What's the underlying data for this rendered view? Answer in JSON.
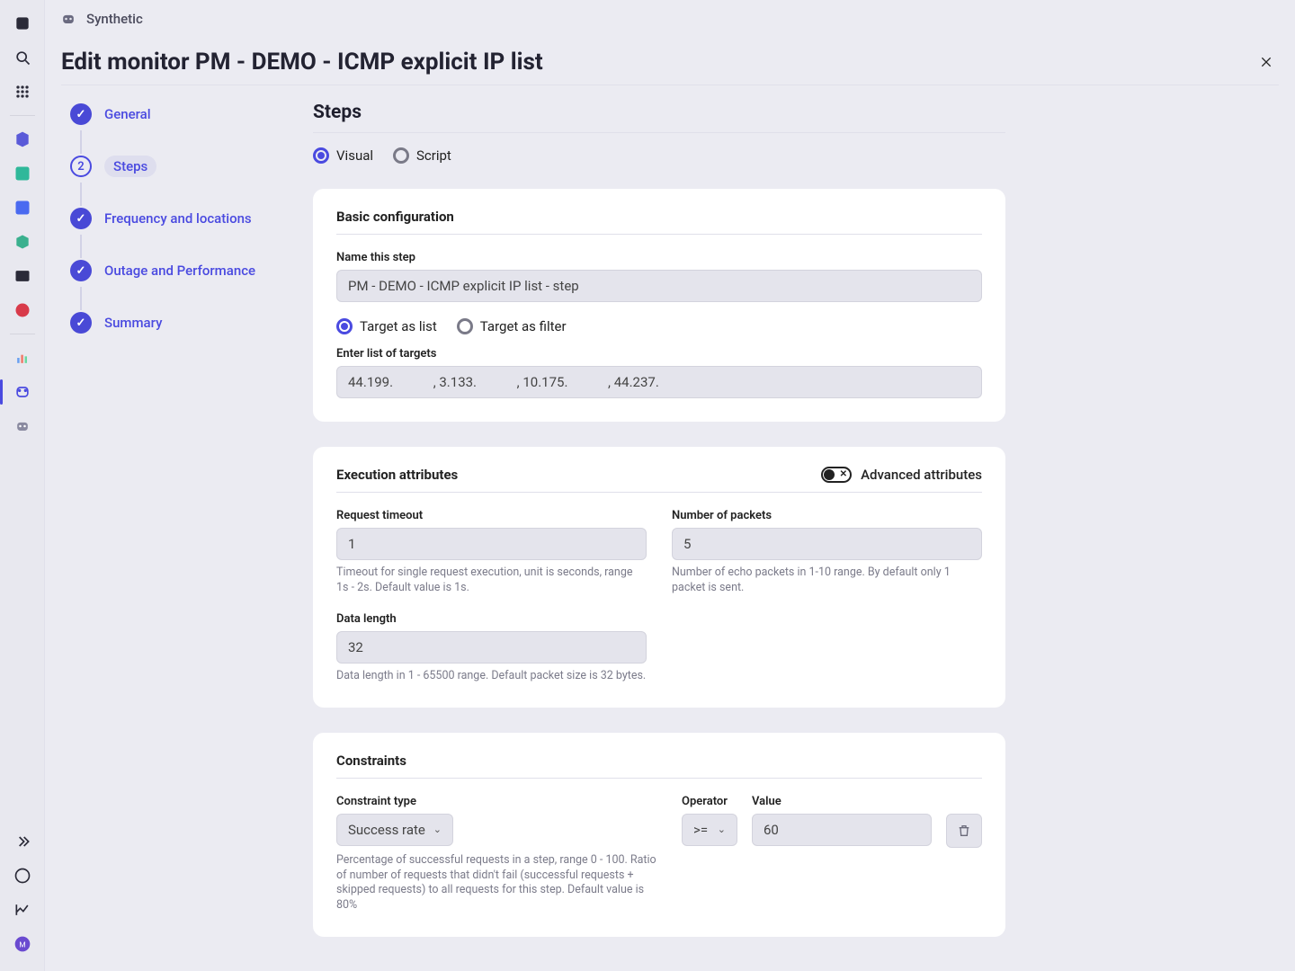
{
  "crumb": {
    "label": "Synthetic"
  },
  "header": {
    "title": "Edit monitor PM - DEMO - ICMP explicit IP list"
  },
  "stepper": {
    "items": [
      {
        "label": "General",
        "state": "done"
      },
      {
        "label": "Steps",
        "state": "current",
        "number": "2"
      },
      {
        "label": "Frequency and locations",
        "state": "done"
      },
      {
        "label": "Outage and Performance",
        "state": "done"
      },
      {
        "label": "Summary",
        "state": "done"
      }
    ]
  },
  "steps": {
    "heading": "Steps",
    "mode": {
      "visual": "Visual",
      "script": "Script",
      "selected": "visual"
    }
  },
  "basic": {
    "title": "Basic configuration",
    "name_label": "Name this step",
    "name_value": "PM - DEMO - ICMP explicit IP list - step",
    "target_mode": {
      "list": "Target as list",
      "filter": "Target as filter",
      "selected": "list"
    },
    "targets_label": "Enter list of targets",
    "targets_value": "44.199.            , 3.133.            , 10.175.            , 44.237."
  },
  "exec": {
    "title": "Execution attributes",
    "advanced_label": "Advanced attributes",
    "timeout": {
      "label": "Request timeout",
      "value": "1",
      "help": "Timeout for single request execution, unit is seconds, range 1s - 2s. Default value is 1s."
    },
    "packets": {
      "label": "Number of packets",
      "value": "5",
      "help": "Number of echo packets in 1-10 range. By default only 1 packet is sent."
    },
    "datalen": {
      "label": "Data length",
      "value": "32",
      "help": "Data length in 1 - 65500 range. Default packet size is 32 bytes."
    }
  },
  "constraints": {
    "title": "Constraints",
    "type_label": "Constraint type",
    "type_value": "Success rate",
    "operator_label": "Operator",
    "operator_value": ">=",
    "value_label": "Value",
    "value_value": "60",
    "help": "Percentage of successful requests in a step, range 0 - 100. Ratio of number of requests that didn't fail (successful requests + skipped requests) to all requests for this step. Default value is 80%"
  }
}
